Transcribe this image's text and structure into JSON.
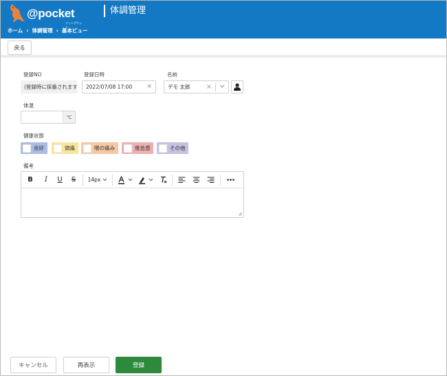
{
  "header": {
    "logo_text": "@pocket",
    "logo_sub": "アットポケット",
    "app_title": "体調管理",
    "breadcrumb": [
      "ホーム",
      "体調管理",
      "基本ビュー"
    ],
    "colors": {
      "primary": "#1479c4"
    }
  },
  "toolbar": {
    "back_label": "戻る"
  },
  "form": {
    "reg_no": {
      "label": "登録NO",
      "value": "(登録時に採番されます"
    },
    "reg_date": {
      "label": "登録日時",
      "value": "2022/07/08 17:00"
    },
    "name": {
      "label": "名前",
      "value": "デモ 太郎"
    },
    "temperature": {
      "label": "体温",
      "value": "",
      "unit": "℃"
    },
    "health": {
      "label": "健康状態",
      "options": [
        {
          "label": "良好",
          "color": "#a9bde6"
        },
        {
          "label": "頭痛",
          "color": "#fbe59a"
        },
        {
          "label": "喉の痛み",
          "color": "#f5c8a3"
        },
        {
          "label": "倦怠感",
          "color": "#ecb0b0"
        },
        {
          "label": "その他",
          "color": "#c9bfe0"
        }
      ]
    },
    "remarks": {
      "label": "備考",
      "font_size": "14px",
      "content": ""
    }
  },
  "footer": {
    "cancel_label": "キャンセル",
    "redisplay_label": "再表示",
    "register_label": "登録",
    "register_color": "#2d8a3c"
  }
}
